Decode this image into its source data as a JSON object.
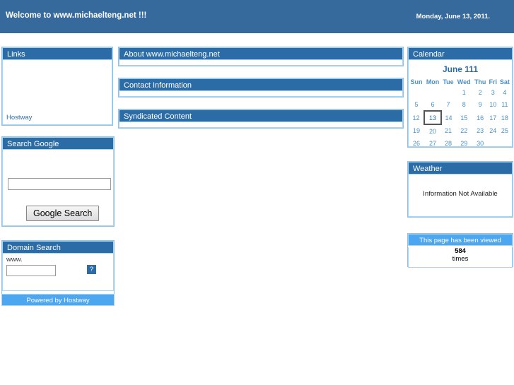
{
  "banner": {
    "title": "Welcome to www.michaelteng.net !!!",
    "date": "Monday, June 13, 2011.",
    "bg_color": "#36699C"
  },
  "theme": {
    "panel_header_color": "#2C6CA6",
    "panel_border_color": "#8FC4E8",
    "bright_bar_color": "#4DA6F0",
    "link_color": "#2C6CA6",
    "calendar_text_color": "#4A90C8"
  },
  "left_column": {
    "links_panel": {
      "header": "Links",
      "link_label": "Hostway"
    },
    "google_panel": {
      "header": "Search Google",
      "input_value": "",
      "input_placeholder": "",
      "button_label": "Google Search"
    },
    "domain_panel": {
      "header": "Domain Search",
      "prefix_label": "www.",
      "input_value": "",
      "input_placeholder": "",
      "image_icon": "broken-image-icon",
      "icon_glyph": "?"
    },
    "footer": {
      "label": "Powered by Hostway"
    }
  },
  "center_column": {
    "panels": [
      {
        "header": "About www.michaelteng.net"
      },
      {
        "header": "Contact Information"
      },
      {
        "header": "Syndicated Content"
      }
    ]
  },
  "right_column": {
    "calendar": {
      "header": "Calendar",
      "title": "June 111",
      "weekdays": [
        "Sun",
        "Mon",
        "Tue",
        "Wed",
        "Thu",
        "Fri",
        "Sat"
      ],
      "weeks": [
        [
          "",
          "",
          "",
          "1",
          "2",
          "3",
          "4"
        ],
        [
          "5",
          "6",
          "7",
          "8",
          "9",
          "10",
          "11"
        ],
        [
          "12",
          "13",
          "14",
          "15",
          "16",
          "17",
          "18"
        ],
        [
          "19",
          "20",
          "21",
          "22",
          "23",
          "24",
          "25"
        ],
        [
          "26",
          "27",
          "28",
          "29",
          "30",
          "",
          ""
        ]
      ],
      "today": "13"
    },
    "weather": {
      "header": "Weather",
      "message": "Information Not Available"
    },
    "counter": {
      "header": "This page has been viewed",
      "count": "584",
      "unit": "times"
    }
  }
}
